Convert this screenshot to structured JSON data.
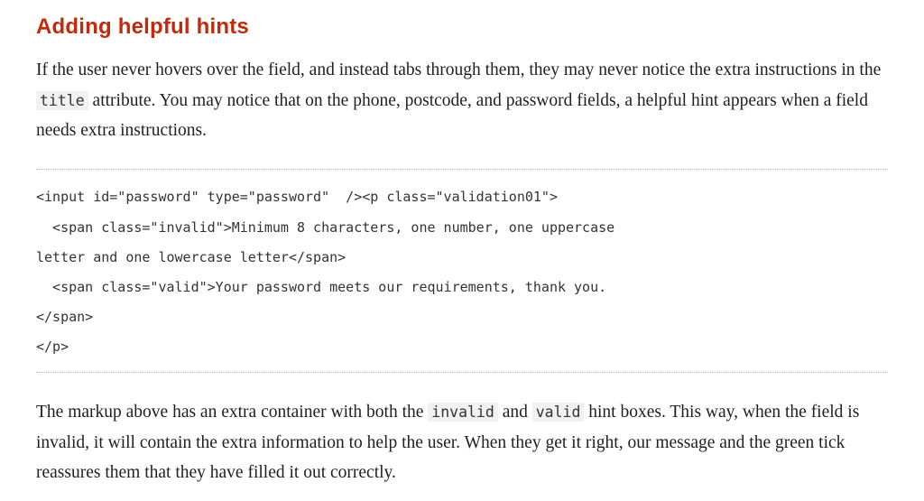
{
  "heading": "Adding helpful hints",
  "para1": {
    "before": "If the user never hovers over the field, and instead tabs through them, they may never notice the extra instructions in the ",
    "code": "title",
    "after": " attribute. You may notice that on the phone, postcode, and password fields, a helpful hint appears when a field needs extra instructions."
  },
  "code_lines": [
    "<input id=\"password\" type=\"password\"  /><p class=\"validation01\">",
    "  <span class=\"invalid\">Minimum 8 characters, one number, one uppercase",
    "letter and one lowercase letter</span>",
    "  <span class=\"valid\">Your password meets our requirements, thank you.",
    "</span>",
    "</p>"
  ],
  "para2": {
    "part1": "The markup above has an extra container with both the ",
    "code1": "invalid",
    "part2": " and ",
    "code2": "valid",
    "part3": " hint boxes. This way, when the field is invalid, it will contain the extra information to help the user. When they get it right, our message and the green tick reassures them that they have filled it out correctly."
  }
}
